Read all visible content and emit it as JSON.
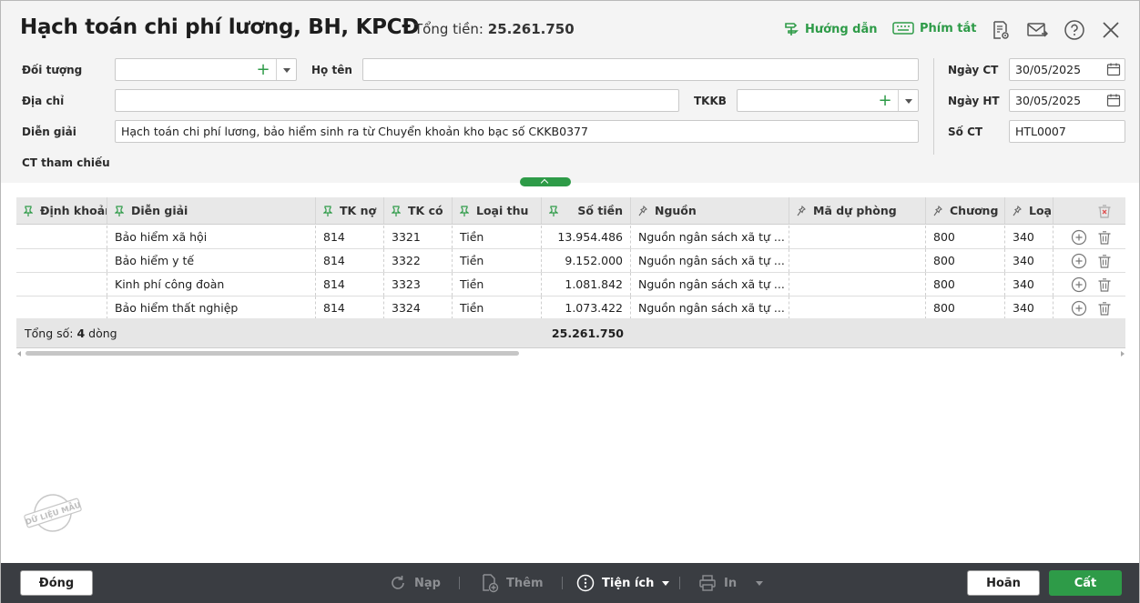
{
  "header": {
    "title": "Hạch toán chi phí lương, BH, KPCĐ",
    "total_label": "Tổng tiền:",
    "total_value": "25.261.750",
    "guide": "Hướng dẫn",
    "shortcuts": "Phím tắt"
  },
  "form": {
    "doi_tuong_label": "Đối tượng",
    "doi_tuong_value": "",
    "ho_ten_label": "Họ tên",
    "ho_ten_value": "",
    "dia_chi_label": "Địa chỉ",
    "dia_chi_value": "",
    "tkkb_label": "TKKB",
    "tkkb_value": "",
    "dien_giai_label": "Diễn giải",
    "dien_giai_value": "Hạch toán chi phí lương, bảo hiểm sinh ra từ Chuyển khoản kho bạc số CKKB0377",
    "ct_tham_chieu_label": "CT tham chiếu",
    "ngay_ct_label": "Ngày CT",
    "ngay_ct_value": "30/05/2025",
    "ngay_ht_label": "Ngày HT",
    "ngay_ht_value": "30/05/2025",
    "so_ct_label": "Số CT",
    "so_ct_value": "HTL0007"
  },
  "grid": {
    "columns": [
      "Định khoản",
      "Diễn giải",
      "TK nợ",
      "TK có",
      "Loại thu",
      "Số tiền",
      "Nguồn",
      "Mã dự phòng",
      "Chương",
      "Loại"
    ],
    "rows": [
      [
        "",
        "Bảo hiểm xã hội",
        "814",
        "3321",
        "Tiền",
        "13.954.486",
        "Nguồn ngân sách xã tự ...",
        "",
        "800",
        "340"
      ],
      [
        "",
        "Bảo hiểm y tế",
        "814",
        "3322",
        "Tiền",
        "9.152.000",
        "Nguồn ngân sách xã tự ...",
        "",
        "800",
        "340"
      ],
      [
        "",
        "Kinh phí công đoàn",
        "814",
        "3323",
        "Tiền",
        "1.081.842",
        "Nguồn ngân sách xã tự ...",
        "",
        "800",
        "340"
      ],
      [
        "",
        "Bảo hiểm thất nghiệp",
        "814",
        "3324",
        "Tiền",
        "1.073.422",
        "Nguồn ngân sách xã tự ...",
        "",
        "800",
        "340"
      ]
    ],
    "footer_label": "Tổng số:",
    "footer_count": "4",
    "footer_unit": "dòng",
    "footer_total": "25.261.750"
  },
  "stamp": "DỮ LIỆU MẪU",
  "footer": {
    "close": "Đóng",
    "reload": "Nạp",
    "add": "Thêm",
    "utilities": "Tiện ích",
    "print": "In",
    "undo": "Hoãn",
    "save": "Cất"
  },
  "colors": {
    "accent": "#2e9b48",
    "footer_bg": "#3a3d42"
  }
}
